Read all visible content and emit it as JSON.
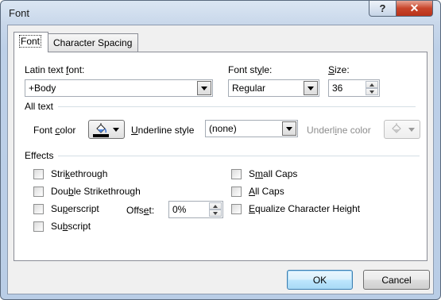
{
  "window": {
    "title": "Font",
    "help_label": "?",
    "close_label": "✕"
  },
  "tabs": [
    {
      "label": "Font",
      "selected": true
    },
    {
      "label": "Character Spacing",
      "selected": false
    }
  ],
  "latin_font": {
    "label_pre": "Latin text ",
    "label_u": "f",
    "label_post": "ont:",
    "value": "+Body"
  },
  "font_style": {
    "label_pre": "Font st",
    "label_u": "y",
    "label_post": "le:",
    "value": "Regular"
  },
  "size": {
    "label_u": "S",
    "label_post": "ize:",
    "value": "36"
  },
  "all_text": {
    "heading": "All text",
    "font_color_pre": "Font ",
    "font_color_u": "c",
    "font_color_post": "olor",
    "font_color_value": "#000000",
    "underline_style_pre": "",
    "underline_style_u": "U",
    "underline_style_post": "nderline style",
    "underline_style_value": "(none)",
    "underline_color_pre": "Underl",
    "underline_color_u": "i",
    "underline_color_post": "ne color"
  },
  "effects": {
    "heading": "Effects",
    "strikethrough": {
      "pre": "Stri",
      "u": "k",
      "post": "ethrough",
      "checked": false
    },
    "double_strikethrough": {
      "pre": "Dou",
      "u": "b",
      "post": "le Strikethrough",
      "checked": false
    },
    "superscript": {
      "pre": "Su",
      "u": "p",
      "post": "erscript",
      "checked": false
    },
    "subscript": {
      "pre": "Su",
      "u": "b",
      "post": "script",
      "checked": false
    },
    "offset": {
      "pre": "Offs",
      "u": "e",
      "post": "t:",
      "value": "0%"
    },
    "small_caps": {
      "pre": "S",
      "u": "m",
      "post": "all Caps",
      "checked": false
    },
    "all_caps": {
      "pre": "",
      "u": "A",
      "post": "ll Caps",
      "checked": false
    },
    "equalize": {
      "pre": "",
      "u": "E",
      "post": "qualize Character Height",
      "checked": false
    }
  },
  "buttons": {
    "ok": "OK",
    "cancel": "Cancel"
  },
  "icons": {
    "paint_bucket": "paint-bucket-icon",
    "dropdown": "chevron-down-icon"
  }
}
